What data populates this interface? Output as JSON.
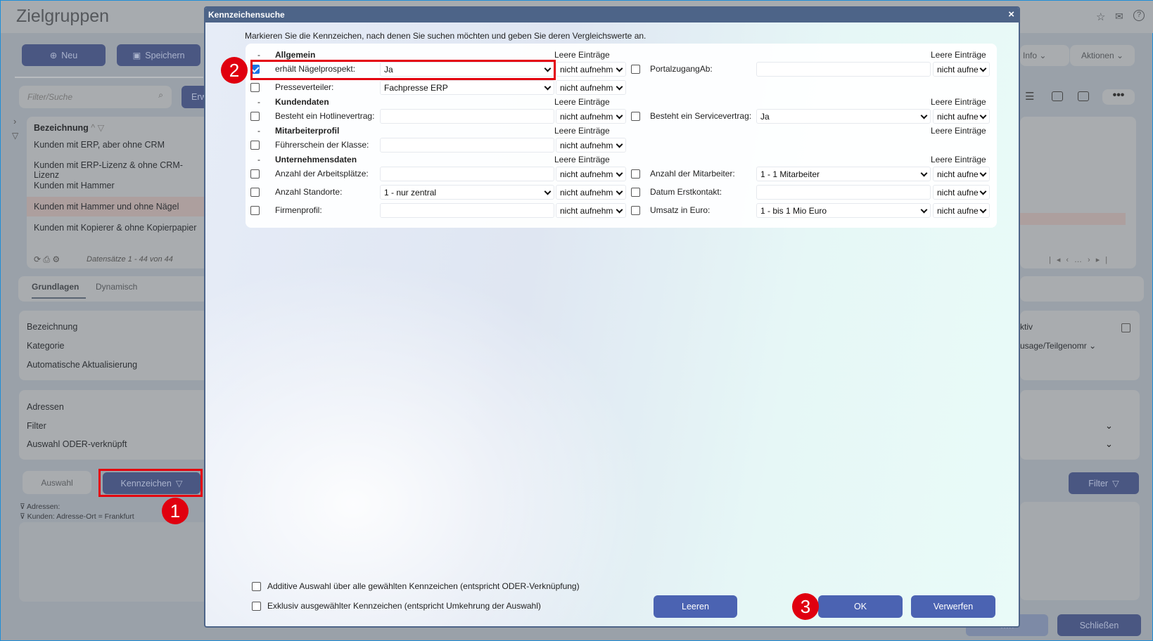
{
  "background": {
    "page_title": "Zielgruppen",
    "new_button": "Neu",
    "save_button": "Speichern",
    "search_placeholder": "Filter/Suche",
    "extended_button": "Erw",
    "list_header": "Bezeichnung",
    "list_items": [
      "Kunden mit ERP, aber ohne CRM",
      "Kunden mit ERP-Lizenz & ohne CRM-Lizenz",
      "Kunden mit Hammer",
      "Kunden mit Hammer und ohne Nägel",
      "Kunden mit Kopierer & ohne Kopierpapier"
    ],
    "selected_item_index": 3,
    "records_text": "Datensätze 1 - 44 von 44",
    "tabs": [
      "Grundlagen",
      "Dynamisch"
    ],
    "basics_fields": [
      "Bezeichnung",
      "Kategorie",
      "Automatische Aktualisierung"
    ],
    "address_fields": [
      "Adressen",
      "Filter",
      "Auswahl ODER-verknüpft"
    ],
    "selection_button": "Auswahl",
    "flags_button": "Kennzeichen",
    "filter_notes": [
      "Adressen:",
      "Kunden: Adresse-Ort = Frankfurt"
    ],
    "info_menu": "Info",
    "actions_menu": "Aktionen",
    "right_active_label": "ktiv",
    "right_select_value": "usage/Teilgenomr",
    "filter_button": "Filter",
    "close_button": "Schließen",
    "hidden_button": "…n"
  },
  "dialog": {
    "title": "Kennzeichensuche",
    "close_glyph": "×",
    "description": "Markieren Sie die Kennzeichen, nach denen Sie suchen möchten und geben Sie deren Vergleichswerte an.",
    "rows": [
      {
        "kind": "section",
        "title": "Allgemein",
        "empty_left": "Leere Einträge",
        "empty_right": "Leere Einträge"
      },
      {
        "kind": "field",
        "left": {
          "label": "erhält Nägelprospekt:",
          "checked": true,
          "type": "select",
          "value": "Ja",
          "empty": "nicht aufnehm"
        },
        "right": {
          "label": "PortalzugangAb:",
          "checked": false,
          "type": "text",
          "value": "",
          "empty": "nicht aufne"
        }
      },
      {
        "kind": "field",
        "left": {
          "label": "Presseverteiler:",
          "checked": false,
          "type": "select",
          "value": "Fachpresse ERP",
          "empty": "nicht aufnehm"
        }
      },
      {
        "kind": "section",
        "title": "Kundendaten",
        "empty_left": "Leere Einträge",
        "empty_right": "Leere Einträge"
      },
      {
        "kind": "field",
        "left": {
          "label": "Besteht ein Hotlinevertrag:",
          "checked": false,
          "type": "text",
          "value": "",
          "empty": "nicht aufnehm"
        },
        "right": {
          "label": "Besteht ein Servicevertrag:",
          "checked": false,
          "type": "select",
          "value": "Ja",
          "empty": "nicht aufne"
        }
      },
      {
        "kind": "section",
        "title": "Mitarbeiterprofil",
        "empty_left": "Leere Einträge",
        "empty_right": "Leere Einträge"
      },
      {
        "kind": "field",
        "left": {
          "label": "Führerschein der Klasse:",
          "checked": false,
          "type": "text",
          "value": "",
          "empty": "nicht aufnehm"
        }
      },
      {
        "kind": "section",
        "title": "Unternehmensdaten",
        "empty_left": "Leere Einträge",
        "empty_right": "Leere Einträge"
      },
      {
        "kind": "field",
        "left": {
          "label": "Anzahl der Arbeitsplätze:",
          "checked": false,
          "type": "text",
          "value": "",
          "empty": "nicht aufnehm"
        },
        "right": {
          "label": "Anzahl der Mitarbeiter:",
          "checked": false,
          "type": "select",
          "value": "1 - 1 Mitarbeiter",
          "empty": "nicht aufne"
        }
      },
      {
        "kind": "field",
        "left": {
          "label": "Anzahl Standorte:",
          "checked": false,
          "type": "select",
          "value": "1 - nur zentral",
          "empty": "nicht aufnehm"
        },
        "right": {
          "label": "Datum Erstkontakt:",
          "checked": false,
          "type": "text",
          "value": "",
          "empty": "nicht aufne"
        }
      },
      {
        "kind": "field",
        "left": {
          "label": "Firmenprofil:",
          "checked": false,
          "type": "text",
          "value": "",
          "empty": "nicht aufnehm"
        },
        "right": {
          "label": "Umsatz in Euro:",
          "checked": false,
          "type": "select",
          "value": "1 - bis 1 Mio Euro",
          "empty": "nicht aufne"
        }
      }
    ],
    "additive_option": "Additive Auswahl über alle gewählten Kennzeichen (entspricht ODER-Verknüpfung)",
    "exclusive_option": "Exklusiv ausgewählter Kennzeichen (entspricht Umkehrung der Auswahl)",
    "clear_button": "Leeren",
    "ok_button": "OK",
    "discard_button": "Verwerfen",
    "section_toggle": "-"
  },
  "annotations": {
    "step1": "1",
    "step2": "2",
    "step3": "3",
    "color": "#e0000f"
  }
}
